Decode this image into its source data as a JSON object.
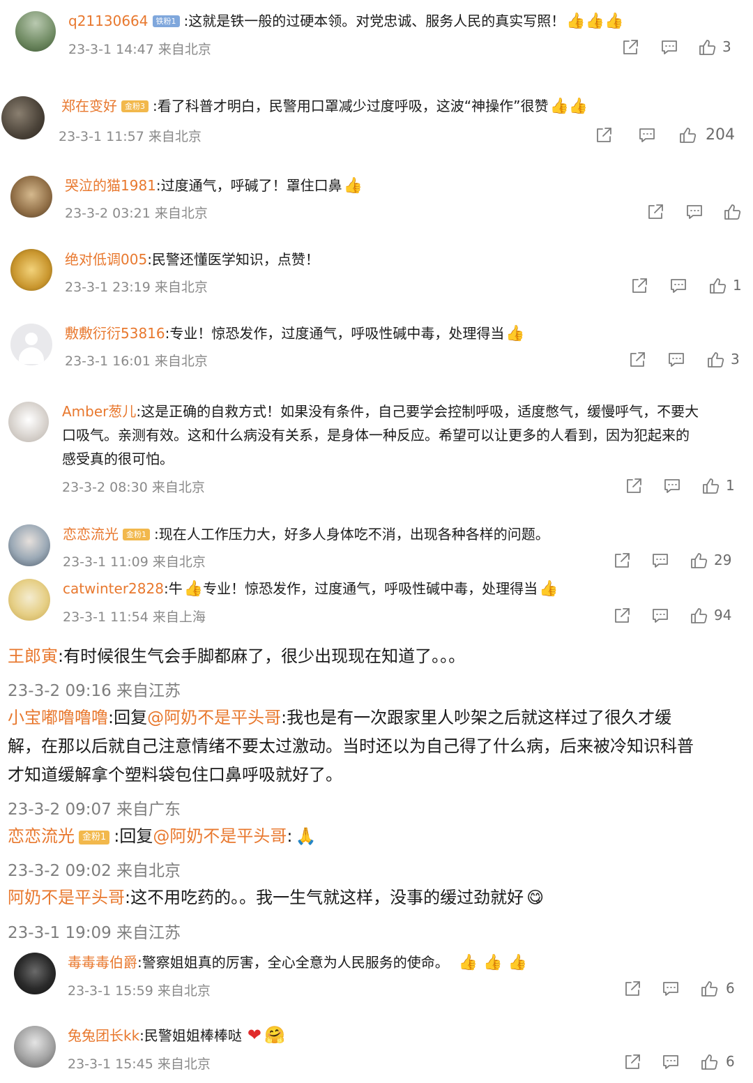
{
  "comments": [
    {
      "user": "q21130664",
      "badge": "铁粉1",
      "text": ":这就是铁一般的过硬本领。对党忠诚、服务人民的真实写照！",
      "meta": "23-3-1 14:47 来自北京",
      "likes": "3"
    },
    {
      "user": "郑在变好",
      "badge": "金粉3",
      "text": ":看了科普才明白，民警用口罩减少过度呼吸，这波“神操作”很赞",
      "meta": "23-3-1 11:57 来自北京",
      "likes": "204"
    },
    {
      "user": "哭泣的猫1981",
      "text": ":过度通气，呼碱了！罩住口鼻",
      "meta": "23-3-2 03:21 来自北京",
      "likes": ""
    },
    {
      "user": "绝对低调005",
      "text": ":民警还懂医学知识，点赞！",
      "meta": "23-3-1 23:19 来自北京",
      "likes": "1"
    },
    {
      "user": "敷敷衍衍53816",
      "text": ":专业！惊恐发作，过度通气，呼吸性碱中毒，处理得当",
      "meta": "23-3-1 16:01 来自北京",
      "likes": "3"
    },
    {
      "user": "Amber葱儿",
      "text_lines": [
        ":这是正确的自救方式！如果没有条件，自己要学会控制呼吸，适度憋气，缓慢呼气，不要大",
        "口吸气。亲测有效。这和什么病没有关系，是身体一种反应。希望可以让更多的人看到，因为犯起来的",
        "感受真的很可怕。"
      ],
      "meta": "23-3-2 08:30 来自北京",
      "likes": "1"
    },
    {
      "user": "恋恋流光",
      "badge": "金粉1",
      "text": ":现在人工作压力大，好多人身体吃不消，出现各种各样的问题。",
      "meta": "23-3-1 11:09 来自北京",
      "likes": "29"
    },
    {
      "user": "catwinter2828",
      "text_a": ":牛",
      "text_b": "专业！惊恐发作，过度通气，呼吸性碱中毒，处理得当",
      "meta": "23-3-1 11:54 来自上海",
      "likes": "94"
    },
    {
      "user": "毒毒毒伯爵",
      "text": ":警察姐姐真的厉害，全心全意为人民服务的使命。",
      "meta": "23-3-1 15:59 来自北京",
      "likes": "6"
    },
    {
      "user": "兔兔团长kk",
      "text": ":民警姐姐棒棒哒",
      "meta": "23-3-1 15:45 来自北京",
      "likes": "6"
    }
  ],
  "replies": [
    {
      "user": "王郎寅",
      "text": ":有时候很生气会手脚都麻了，很少出现现在知道了。。。",
      "meta": "23-3-2 09:16 来自江苏"
    },
    {
      "user": "小宝嘟噜噜噜",
      "reply_prefix": ":回复",
      "mention": "@阿奶不是平头哥",
      "text_lines": [
        ":我也是有一次跟家里人吵架之后就这样过了很久才缓",
        "解，在那以后就自己注意情绪不要太过激动。当时还以为自己得了什么病，后来被冷知识科普",
        "才知道缓解拿个塑料袋包住口鼻呼吸就好了。"
      ],
      "meta": "23-3-2 09:07 来自广东"
    },
    {
      "user": "恋恋流光",
      "badge": "金粉1",
      "reply_prefix": ":回复",
      "mention": "@阿奶不是平头哥",
      "text": ":",
      "meta": "23-3-2 09:02 来自北京"
    },
    {
      "user": "阿奶不是平头哥",
      "text": ":这不用吃药的。。我一生气就这样，没事的缓过劲就好",
      "meta": "23-3-1 19:09 来自江苏"
    }
  ],
  "colors": {
    "username": "#e8782e",
    "meta": "#8a8a8a",
    "icon": "#7d7d7d"
  },
  "icons": [
    "share-icon",
    "comment-icon",
    "like-icon"
  ]
}
